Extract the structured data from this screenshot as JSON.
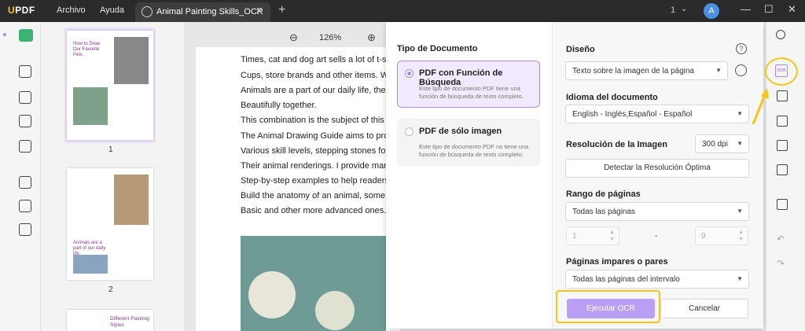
{
  "app": {
    "logo": "UPDF"
  },
  "menu": {
    "file": "Archivo",
    "help": "Ayuda"
  },
  "tab": {
    "title": "Animal Painting Skills_OCR",
    "close": "✕"
  },
  "titlebar": {
    "page_indicator": "1",
    "avatar_letter": "A",
    "add_tab": "+"
  },
  "zoom": {
    "level": "126%"
  },
  "thumbnails": {
    "pages": [
      {
        "label": "1",
        "caption": "How to Draw Our Favorite Pets"
      },
      {
        "label": "2",
        "caption": "Animals are a part of our daily life"
      },
      {
        "label": "",
        "caption": "Different Painting Styles"
      }
    ]
  },
  "document": {
    "lines": [
      "Times, cat and dog art sells a lot of t-shirts, ca",
      "Cups, store brands and other items. Whether",
      "Animals are a part of our daily life, the combin",
      "Beautifully together.",
      "This combination is the subject of this book, a",
      "The Animal Drawing Guide aims to provide pe",
      "Various skill levels, stepping stones for improv",
      "Their animal renderings. I provide many sketc",
      "Step-by-step examples to help readers see th",
      "Build the anatomy of an animal, some of them",
      "Basic and other more advanced ones. Please"
    ]
  },
  "ocr": {
    "doc_type_heading": "Tipo de Documento",
    "option_searchable": {
      "title": "PDF con Función de Búsqueda",
      "desc": "Este tipo de documento PDF tiene una función de búsqueda de texto completo."
    },
    "option_image": {
      "title": "PDF de sólo imagen",
      "desc": "Este tipo de documento PDF no tiene una función de búsqueda de texto completo."
    },
    "layout_heading": "Diseño",
    "layout_value": "Texto sobre la imagen de la página",
    "language_heading": "Idioma del documento",
    "language_value": "English - Inglés,Español - Español",
    "resolution_heading": "Resolución de la Imagen",
    "resolution_value": "300 dpi",
    "detect_button": "Detectar la Resolución Óptima",
    "range_heading": "Rango de páginas",
    "range_value": "Todas las páginas",
    "range_from": "1",
    "range_to": "9",
    "range_dash": "-",
    "parity_heading": "Páginas impares o pares",
    "parity_value": "Todas las páginas del intervalo",
    "run_button": "Ejecutar OCR",
    "cancel_button": "Cancelar"
  },
  "colors": {
    "accent": "#a98bf0",
    "highlight": "#f5c518",
    "brand_yellow": "#fbc02d"
  }
}
